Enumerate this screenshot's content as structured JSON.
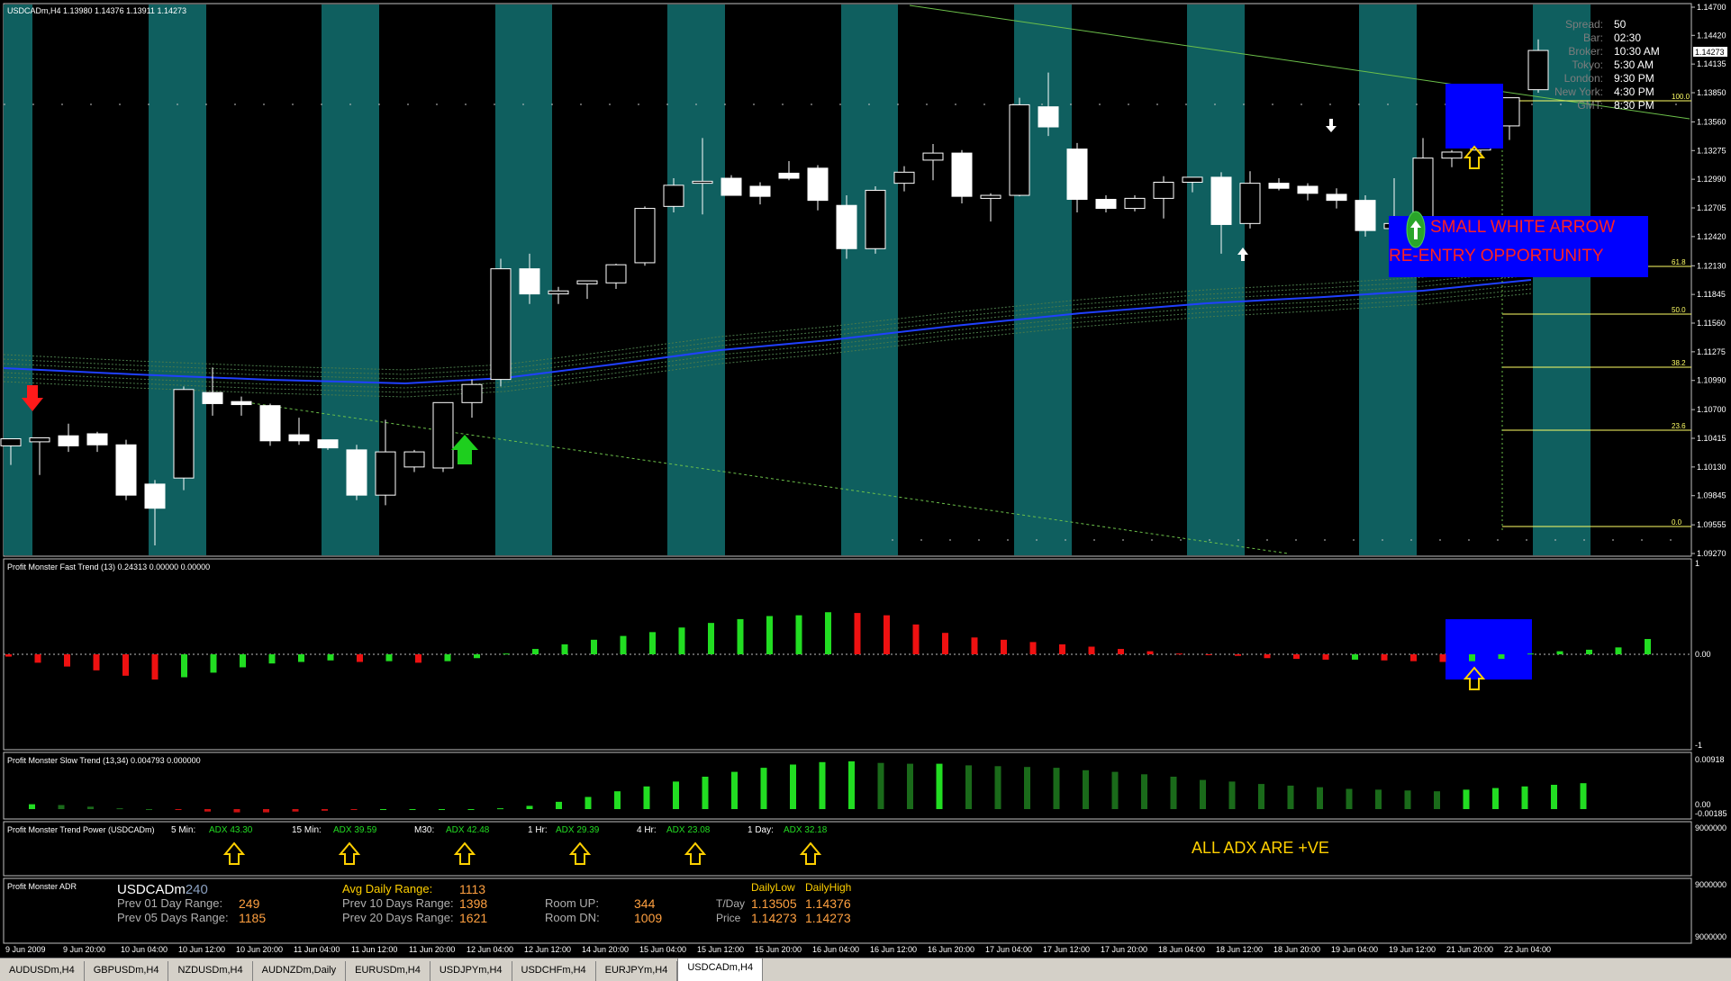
{
  "window": {
    "title": "USDCADm,H4  1.13980 1.14376 1.13911 1.14273",
    "current_price": "1.14273"
  },
  "price_axis": [
    "1.14700",
    "1.14420",
    "1.14135",
    "1.13850",
    "1.13560",
    "1.13275",
    "1.12990",
    "1.12705",
    "1.12420",
    "1.12130",
    "1.11845",
    "1.11560",
    "1.11275",
    "1.10990",
    "1.10700",
    "1.10415",
    "1.10130",
    "1.09845",
    "1.09555",
    "1.09270"
  ],
  "time_axis": [
    "9 Jun 2009",
    "9 Jun 20:00",
    "10 Jun 04:00",
    "10 Jun 12:00",
    "10 Jun 20:00",
    "11 Jun 04:00",
    "11 Jun 12:00",
    "11 Jun 20:00",
    "12 Jun 04:00",
    "12 Jun 12:00",
    "14 Jun 20:00",
    "15 Jun 04:00",
    "15 Jun 12:00",
    "15 Jun 20:00",
    "16 Jun 04:00",
    "16 Jun 12:00",
    "16 Jun 20:00",
    "17 Jun 04:00",
    "17 Jun 12:00",
    "17 Jun 20:00",
    "18 Jun 04:00",
    "18 Jun 12:00",
    "18 Jun 20:00",
    "19 Jun 04:00",
    "19 Jun 12:00",
    "21 Jun 20:00",
    "22 Jun 04:00"
  ],
  "info_panel": {
    "labels": [
      "Spread:",
      "Bar:",
      "Broker:",
      "Tokyo:",
      "London:",
      "New York:",
      "GMT:"
    ],
    "values": [
      "50",
      "02:30",
      "10:30 AM",
      "5:30 AM",
      "9:30 PM",
      "4:30 PM",
      "8:30 PM"
    ]
  },
  "fib_levels": [
    "100.0",
    "61.8",
    "50.0",
    "38.2",
    "23.6",
    "0.0"
  ],
  "annotations": {
    "line1": "SMALL WHITE ARROW",
    "line2": "RE-ENTRY OPPORTUNITY",
    "adx_note": "ALL ADX ARE +VE"
  },
  "fast_trend": {
    "title": "Profit Monster Fast Trend (13) 0.24313 0.00000 0.00000",
    "axis": [
      "1",
      "0.00",
      "-1"
    ]
  },
  "slow_trend": {
    "title": "Profit Monster Slow Trend (13,34) 0.004793 0.000000",
    "axis": [
      "0.00918",
      "0.00",
      "-0.00185"
    ]
  },
  "trend_power": {
    "title": "Profit Monster Trend Power (USDCADm)",
    "axis": "9000000",
    "items": [
      {
        "tf": "5 Min:",
        "adx": "ADX 43.30"
      },
      {
        "tf": "15 Min:",
        "adx": "ADX 39.59"
      },
      {
        "tf": "M30:",
        "adx": "ADX 42.48"
      },
      {
        "tf": "1 Hr:",
        "adx": "ADX 29.39"
      },
      {
        "tf": "4 Hr:",
        "adx": "ADX 23.08"
      },
      {
        "tf": "1 Day:",
        "adx": "ADX 32.18"
      }
    ]
  },
  "adr": {
    "title": "Profit Monster ADR",
    "axis_top": "9000000",
    "axis_bottom": "9000000",
    "symbol": "USDCADm",
    "period": "240",
    "prev01_label": "Prev 01 Day Range:",
    "prev01": "249",
    "prev05_label": "Prev 05 Days Range:",
    "prev05": "1185",
    "avg_label": "Avg Daily Range:",
    "avg": "1113",
    "prev10_label": "Prev 10 Days Range:",
    "prev10": "1398",
    "prev20_label": "Prev 20 Days Range:",
    "prev20": "1621",
    "room_up_label": "Room UP:",
    "room_up": "344",
    "room_dn_label": "Room DN:",
    "room_dn": "1009",
    "daily_low_label": "DailyLow",
    "daily_high_label": "DailyHigh",
    "tday_label": "T/Day",
    "tday_low": "1.13505",
    "tday_high": "1.14376",
    "price_label": "Price",
    "price_low": "1.14273",
    "price_high": "1.14273"
  },
  "tabs": [
    "AUDUSDm,H4",
    "GBPUSDm,H4",
    "NZDUSDm,H4",
    "AUDNZDm,Daily",
    "EURUSDm,H4",
    "USDJPYm,H4",
    "USDCHFm,H4",
    "EURJPYm,H4",
    "USDCADm,H4"
  ],
  "active_tab": "USDCADm,H4",
  "chart_data": {
    "type": "candlestick",
    "candles": [
      {
        "o": 1.1034,
        "h": 1.1041,
        "l": 1.1015,
        "c": 1.1041
      },
      {
        "o": 1.1038,
        "h": 1.1042,
        "l": 1.1005,
        "c": 1.1042
      },
      {
        "o": 1.1044,
        "h": 1.1056,
        "l": 1.1028,
        "c": 1.1034
      },
      {
        "o": 1.1046,
        "h": 1.1048,
        "l": 1.1028,
        "c": 1.1035
      },
      {
        "o": 1.1035,
        "h": 1.104,
        "l": 1.098,
        "c": 1.0985
      },
      {
        "o": 1.0996,
        "h": 1.1,
        "l": 1.0935,
        "c": 1.0972
      },
      {
        "o": 1.1002,
        "h": 1.1093,
        "l": 1.099,
        "c": 1.109
      },
      {
        "o": 1.1087,
        "h": 1.1112,
        "l": 1.1064,
        "c": 1.1076
      },
      {
        "o": 1.1078,
        "h": 1.1083,
        "l": 1.1064,
        "c": 1.1075
      },
      {
        "o": 1.1074,
        "h": 1.1076,
        "l": 1.1034,
        "c": 1.1039
      },
      {
        "o": 1.1045,
        "h": 1.1062,
        "l": 1.1035,
        "c": 1.1039
      },
      {
        "o": 1.104,
        "h": 1.104,
        "l": 1.103,
        "c": 1.1032
      },
      {
        "o": 1.103,
        "h": 1.1035,
        "l": 1.098,
        "c": 1.0985
      },
      {
        "o": 1.0985,
        "h": 1.106,
        "l": 1.0975,
        "c": 1.1028
      },
      {
        "o": 1.1013,
        "h": 1.103,
        "l": 1.1008,
        "c": 1.1028
      },
      {
        "o": 1.1012,
        "h": 1.1077,
        "l": 1.1008,
        "c": 1.1077
      },
      {
        "o": 1.1077,
        "h": 1.11,
        "l": 1.1062,
        "c": 1.1095
      },
      {
        "o": 1.11,
        "h": 1.122,
        "l": 1.1093,
        "c": 1.121
      },
      {
        "o": 1.121,
        "h": 1.1225,
        "l": 1.1175,
        "c": 1.1185
      },
      {
        "o": 1.1185,
        "h": 1.1192,
        "l": 1.1175,
        "c": 1.1188
      },
      {
        "o": 1.1195,
        "h": 1.1198,
        "l": 1.118,
        "c": 1.1198
      },
      {
        "o": 1.1196,
        "h": 1.1215,
        "l": 1.119,
        "c": 1.1214
      },
      {
        "o": 1.1216,
        "h": 1.1272,
        "l": 1.1213,
        "c": 1.127
      },
      {
        "o": 1.1272,
        "h": 1.13,
        "l": 1.1266,
        "c": 1.1293
      },
      {
        "o": 1.1295,
        "h": 1.134,
        "l": 1.1264,
        "c": 1.1297
      },
      {
        "o": 1.13,
        "h": 1.1303,
        "l": 1.1283,
        "c": 1.1283
      },
      {
        "o": 1.1292,
        "h": 1.1296,
        "l": 1.1274,
        "c": 1.1282
      },
      {
        "o": 1.1305,
        "h": 1.1317,
        "l": 1.1298,
        "c": 1.13
      },
      {
        "o": 1.131,
        "h": 1.1313,
        "l": 1.1268,
        "c": 1.1278
      },
      {
        "o": 1.1273,
        "h": 1.1283,
        "l": 1.122,
        "c": 1.123
      },
      {
        "o": 1.123,
        "h": 1.1292,
        "l": 1.1225,
        "c": 1.1288
      },
      {
        "o": 1.1295,
        "h": 1.1312,
        "l": 1.1287,
        "c": 1.1306
      },
      {
        "o": 1.1318,
        "h": 1.1334,
        "l": 1.1298,
        "c": 1.1325
      },
      {
        "o": 1.1325,
        "h": 1.1328,
        "l": 1.1275,
        "c": 1.1282
      },
      {
        "o": 1.128,
        "h": 1.1285,
        "l": 1.1257,
        "c": 1.1283
      },
      {
        "o": 1.1283,
        "h": 1.138,
        "l": 1.1282,
        "c": 1.1373
      },
      {
        "o": 1.1371,
        "h": 1.1405,
        "l": 1.1342,
        "c": 1.1351
      },
      {
        "o": 1.1329,
        "h": 1.1335,
        "l": 1.1266,
        "c": 1.1279
      },
      {
        "o": 1.1279,
        "h": 1.1283,
        "l": 1.1266,
        "c": 1.127
      },
      {
        "o": 1.127,
        "h": 1.1283,
        "l": 1.1267,
        "c": 1.128
      },
      {
        "o": 1.128,
        "h": 1.1302,
        "l": 1.126,
        "c": 1.1296
      },
      {
        "o": 1.1296,
        "h": 1.13,
        "l": 1.1286,
        "c": 1.1301
      },
      {
        "o": 1.1301,
        "h": 1.1306,
        "l": 1.1225,
        "c": 1.1254
      },
      {
        "o": 1.1255,
        "h": 1.1307,
        "l": 1.125,
        "c": 1.1295
      },
      {
        "o": 1.1295,
        "h": 1.13,
        "l": 1.1288,
        "c": 1.129
      },
      {
        "o": 1.1292,
        "h": 1.1295,
        "l": 1.1278,
        "c": 1.1285
      },
      {
        "o": 1.1284,
        "h": 1.129,
        "l": 1.127,
        "c": 1.1278
      },
      {
        "o": 1.1278,
        "h": 1.1283,
        "l": 1.1242,
        "c": 1.1248
      },
      {
        "o": 1.125,
        "h": 1.13,
        "l": 1.1238,
        "c": 1.1255
      },
      {
        "o": 1.1255,
        "h": 1.134,
        "l": 1.1245,
        "c": 1.132
      },
      {
        "o": 1.132,
        "h": 1.1328,
        "l": 1.1311,
        "c": 1.1326
      },
      {
        "o": 1.1328,
        "h": 1.136,
        "l": 1.1322,
        "c": 1.1352
      },
      {
        "o": 1.1352,
        "h": 1.138,
        "l": 1.1338,
        "c": 1.138
      },
      {
        "o": 1.1388,
        "h": 1.1438,
        "l": 1.1385,
        "c": 1.1427
      }
    ],
    "fast_trend_values": [
      -0.03,
      -0.11,
      -0.16,
      -0.21,
      -0.28,
      -0.33,
      -0.3,
      -0.24,
      -0.17,
      -0.12,
      -0.1,
      -0.08,
      -0.1,
      -0.09,
      -0.11,
      -0.09,
      -0.05,
      0.01,
      0.07,
      0.13,
      0.19,
      0.24,
      0.29,
      0.35,
      0.41,
      0.46,
      0.5,
      0.51,
      0.55,
      0.54,
      0.51,
      0.39,
      0.28,
      0.22,
      0.19,
      0.16,
      0.13,
      0.1,
      0.07,
      0.04,
      0.01,
      -0.01,
      -0.02,
      -0.05,
      -0.06,
      -0.07,
      -0.07,
      -0.08,
      -0.09,
      -0.1,
      -0.09,
      -0.06,
      0.01,
      0.04,
      0.06,
      0.09,
      0.2
    ],
    "slow_trend_values": [
      0.0006,
      0.0005,
      0.0003,
      0.0001,
      0.0,
      -0.0001,
      -0.0003,
      -0.0004,
      -0.0004,
      -0.0003,
      -0.0002,
      -0.0001,
      0.0,
      0.0,
      0.0,
      0.0,
      0.0001,
      0.0004,
      0.0009,
      0.0015,
      0.0022,
      0.0028,
      0.0034,
      0.004,
      0.0046,
      0.0051,
      0.0055,
      0.0058,
      0.0059,
      0.0057,
      0.0056,
      0.0056,
      0.0054,
      0.0053,
      0.0052,
      0.0051,
      0.0048,
      0.0046,
      0.0043,
      0.004,
      0.0036,
      0.0034,
      0.0031,
      0.0029,
      0.0027,
      0.0025,
      0.0024,
      0.0023,
      0.0022,
      0.0024,
      0.0026,
      0.0028,
      0.003,
      0.0032
    ]
  }
}
